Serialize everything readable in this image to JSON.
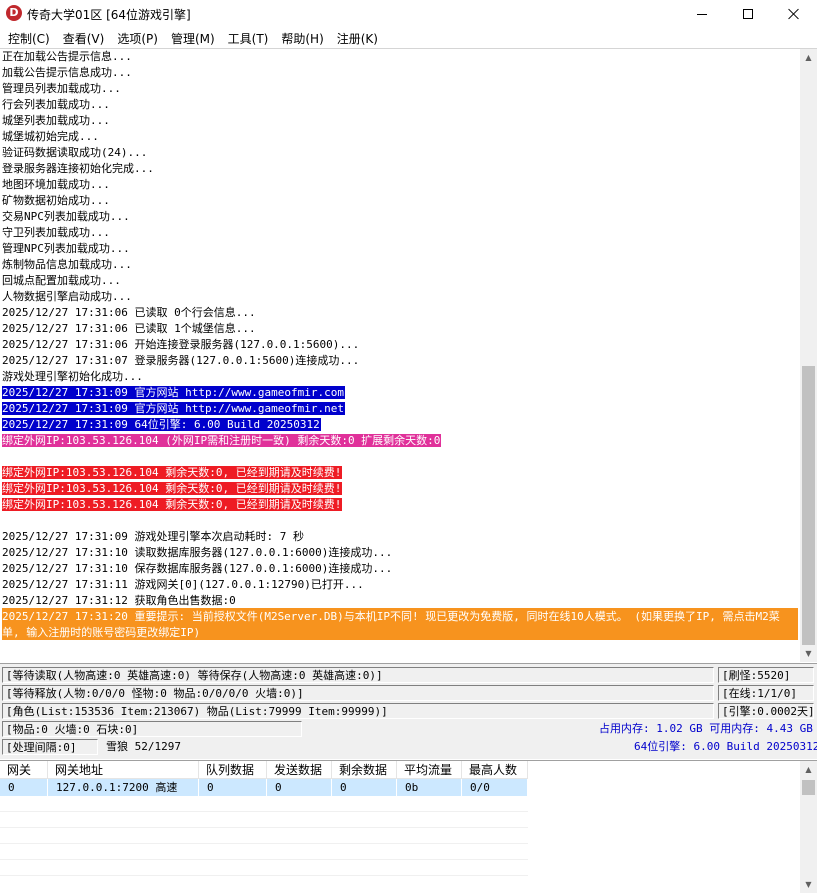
{
  "window": {
    "icon_letter": "D",
    "title": "传奇大学01区 [64位游戏引擎]"
  },
  "menu": [
    "控制(C)",
    "查看(V)",
    "选项(P)",
    "管理(M)",
    "工具(T)",
    "帮助(H)",
    "注册(K)"
  ],
  "log": {
    "lines": [
      {
        "text": "正在加载公告提示信息...",
        "style": "plain"
      },
      {
        "text": "加载公告提示信息成功...",
        "style": "plain"
      },
      {
        "text": "管理员列表加载成功...",
        "style": "plain"
      },
      {
        "text": "行会列表加载成功...",
        "style": "plain"
      },
      {
        "text": "城堡列表加载成功...",
        "style": "plain"
      },
      {
        "text": "城堡城初始完成...",
        "style": "plain"
      },
      {
        "text": "验证码数据读取成功(24)...",
        "style": "plain"
      },
      {
        "text": "登录服务器连接初始化完成...",
        "style": "plain"
      },
      {
        "text": "地图环境加载成功...",
        "style": "plain"
      },
      {
        "text": "矿物数据初始成功...",
        "style": "plain"
      },
      {
        "text": "交易NPC列表加载成功...",
        "style": "plain"
      },
      {
        "text": "守卫列表加载成功...",
        "style": "plain"
      },
      {
        "text": "管理NPC列表加载成功...",
        "style": "plain"
      },
      {
        "text": "炼制物品信息加载成功...",
        "style": "plain"
      },
      {
        "text": "回城点配置加载成功...",
        "style": "plain"
      },
      {
        "text": "人物数据引擎启动成功...",
        "style": "plain"
      },
      {
        "text": "2025/12/27 17:31:06 已读取 0个行会信息...",
        "style": "plain"
      },
      {
        "text": "2025/12/27 17:31:06 已读取 1个城堡信息...",
        "style": "plain"
      },
      {
        "text": "2025/12/27 17:31:06 开始连接登录服务器(127.0.0.1:5600)...",
        "style": "plain"
      },
      {
        "text": "2025/12/27 17:31:07 登录服务器(127.0.0.1:5600)连接成功...",
        "style": "plain"
      },
      {
        "text": "游戏处理引擎初始化成功...",
        "style": "plain"
      },
      {
        "text": "2025/12/27 17:31:09 官方网站 http://www.gameofmir.com",
        "style": "blue"
      },
      {
        "text": "2025/12/27 17:31:09 官方网站 http://www.gameofmir.net",
        "style": "blue"
      },
      {
        "text": "2025/12/27 17:31:09 64位引擎: 6.00 Build 20250312",
        "style": "blue"
      },
      {
        "text": "绑定外网IP:103.53.126.104 (外网IP需和注册时一致) 剩余天数:0 扩展剩余天数:0",
        "style": "magenta"
      },
      {
        "text": "",
        "style": "plain"
      },
      {
        "text": "绑定外网IP:103.53.126.104 剩余天数:0, 已经到期请及时续费!",
        "style": "red"
      },
      {
        "text": "绑定外网IP:103.53.126.104 剩余天数:0, 已经到期请及时续费!",
        "style": "red"
      },
      {
        "text": "绑定外网IP:103.53.126.104 剩余天数:0, 已经到期请及时续费!",
        "style": "red"
      },
      {
        "text": "",
        "style": "plain"
      },
      {
        "text": "2025/12/27 17:31:09 游戏处理引擎本次启动耗时: 7 秒",
        "style": "plain"
      },
      {
        "text": "2025/12/27 17:31:10 读取数据库服务器(127.0.0.1:6000)连接成功...",
        "style": "plain"
      },
      {
        "text": "2025/12/27 17:31:10 保存数据库服务器(127.0.0.1:6000)连接成功...",
        "style": "plain"
      },
      {
        "text": "2025/12/27 17:31:11 游戏网关[0](127.0.0.1:12790)已打开...",
        "style": "plain"
      },
      {
        "text": "2025/12/27 17:31:12 获取角色出售数据:0",
        "style": "plain"
      }
    ],
    "notice_line1": "2025/12/27 17:31:20 重要提示: 当前授权文件(M2Server.DB)与本机IP不同! 现已更改为免费版, 同时在线10人模式。 (如果更换了IP, 需点击M2菜",
    "notice_line2": "单, 输入注册时的账号密码更改绑定IP)"
  },
  "status": {
    "row1": "[等待读取(人物高速:0 英雄高速:0) 等待保存(人物高速:0 英雄高速:0)]",
    "row2": "[等待释放(人物:0/0/0 怪物:0 物品:0/0/0/0 火墙:0)]",
    "row3": "[角色(List:153536 Item:213067) 物品(List:79999 Item:99999)]",
    "row4": "[物品:0 火墙:0 石块:0]",
    "row5": "[处理间隔:0]",
    "row5_extra": "雪狼 52/1297",
    "refresh_monster": "[刷怪:5520]",
    "online": "[在线:1/1/0]",
    "engine_time": "[引擎:0.0002天]",
    "memory": "占用内存: 1.02 GB 可用内存: 4.43 GB",
    "engine_version": "64位引擎: 6.00 Build 20250312"
  },
  "gateway": {
    "columns": [
      "网关",
      "网关地址",
      "队列数据",
      "发送数据",
      "剩余数据",
      "平均流量",
      "最高人数"
    ],
    "rows": [
      [
        "0",
        "127.0.0.1:7200 高速",
        "0",
        "0",
        "0",
        "0b",
        "0/0"
      ]
    ]
  }
}
